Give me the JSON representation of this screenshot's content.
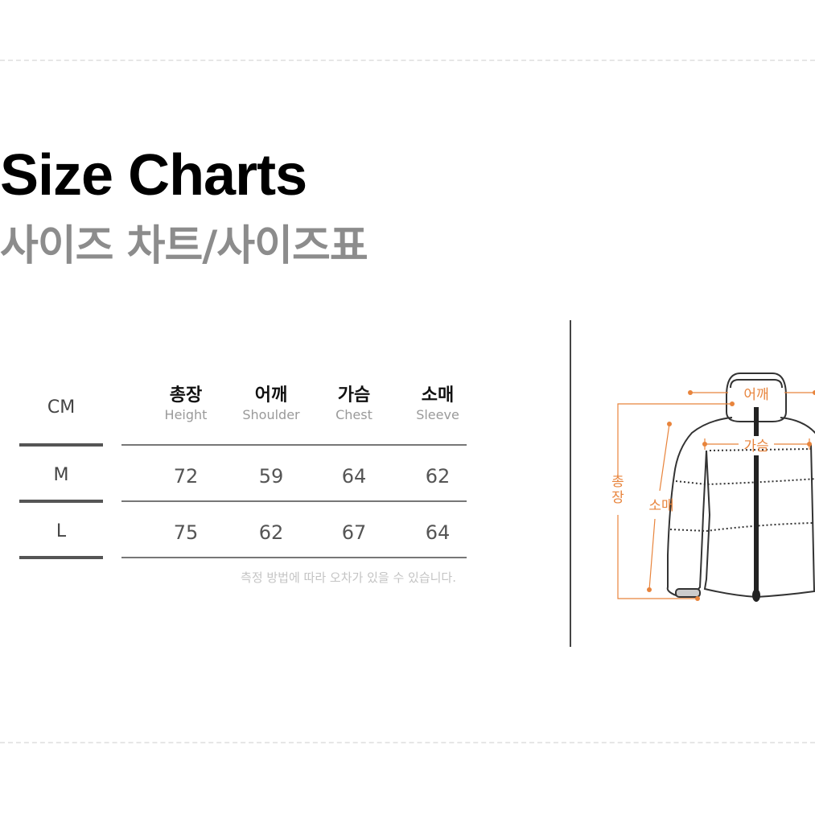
{
  "header": {
    "title": "Size Charts",
    "subtitle": "사이즈 차트/사이즈표"
  },
  "table": {
    "unit": "CM",
    "columns": [
      {
        "ko": "총장",
        "en": "Height"
      },
      {
        "ko": "어깨",
        "en": "Shoulder"
      },
      {
        "ko": "가슴",
        "en": "Chest"
      },
      {
        "ko": "소매",
        "en": "Sleeve"
      }
    ],
    "rows": [
      {
        "size": "M",
        "values": [
          "72",
          "59",
          "64",
          "62"
        ]
      },
      {
        "size": "L",
        "values": [
          "75",
          "62",
          "67",
          "64"
        ]
      }
    ],
    "note": "측정 방법에 따라 오차가 있을 수 있습니다."
  },
  "diagram": {
    "accent_color": "#e8843c",
    "labels": {
      "shoulder": "어깨",
      "chest": "가슴",
      "length": "총장",
      "sleeve": "소매"
    }
  }
}
